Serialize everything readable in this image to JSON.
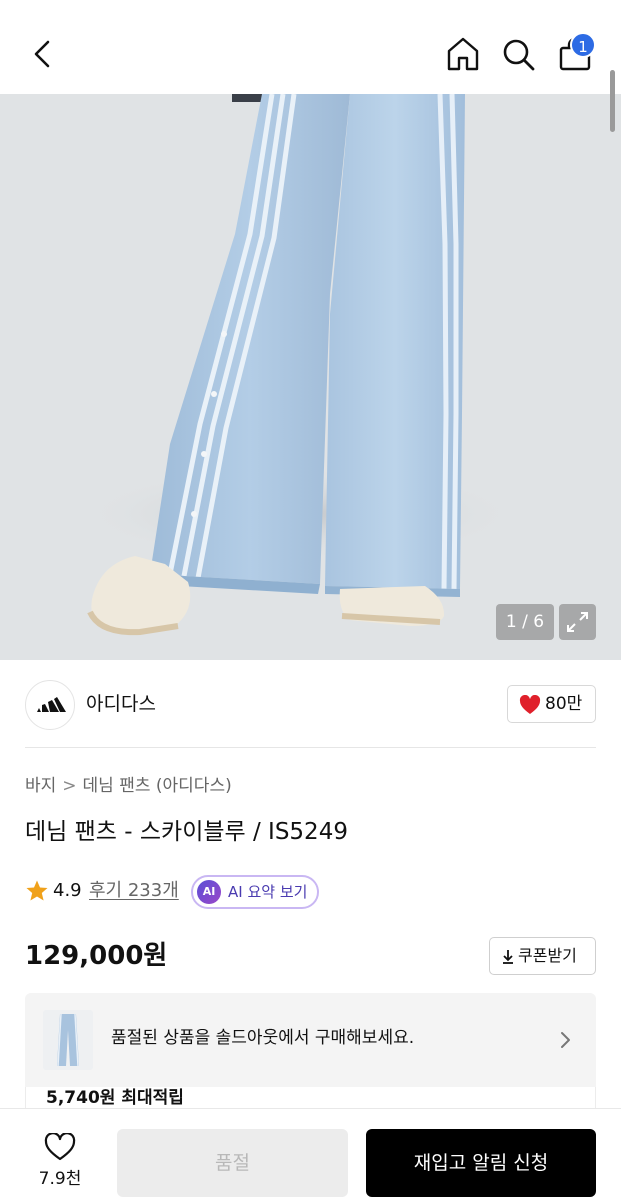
{
  "header": {
    "back_icon": "chevron-left-icon",
    "home_icon": "home-icon",
    "search_icon": "search-icon",
    "cart_icon": "shopping-bag-icon",
    "cart_count": "1",
    "badge_color": "#2d6be4"
  },
  "gallery": {
    "pager_text": "1 / 6",
    "expand_icon": "expand-icon",
    "current_index": 1,
    "total": 6
  },
  "brand": {
    "logo_icon": "adidas-logo",
    "name": "아디다스",
    "likes": "80만",
    "heart_color": "#e0202b"
  },
  "breadcrumb": {
    "items": [
      "바지",
      "데님 팬츠 (아디다스)"
    ],
    "separator": ">"
  },
  "product": {
    "title": "데님 팬츠 - 스카이블루 / IS5249",
    "rating": "4.9",
    "reviews": "후기 233개",
    "ai_badge": "AI",
    "ai_summary": "AI 요약 보기",
    "price": "129,000원",
    "coupon": "쿠폰받기"
  },
  "soldout_banner": {
    "text": "품절된 상품을 솔드아웃에서 구매해보세요.",
    "points": "5,740원 최대적립"
  },
  "bottom_bar": {
    "wish_count": "7.9천",
    "soldout_label": "품절",
    "restock_label": "재입고 알림 신청"
  },
  "colors": {
    "accent": "#2d6be4",
    "star": "#f0a11a",
    "ai_purple": "#6a4fd6",
    "primary_button": "#000000"
  }
}
